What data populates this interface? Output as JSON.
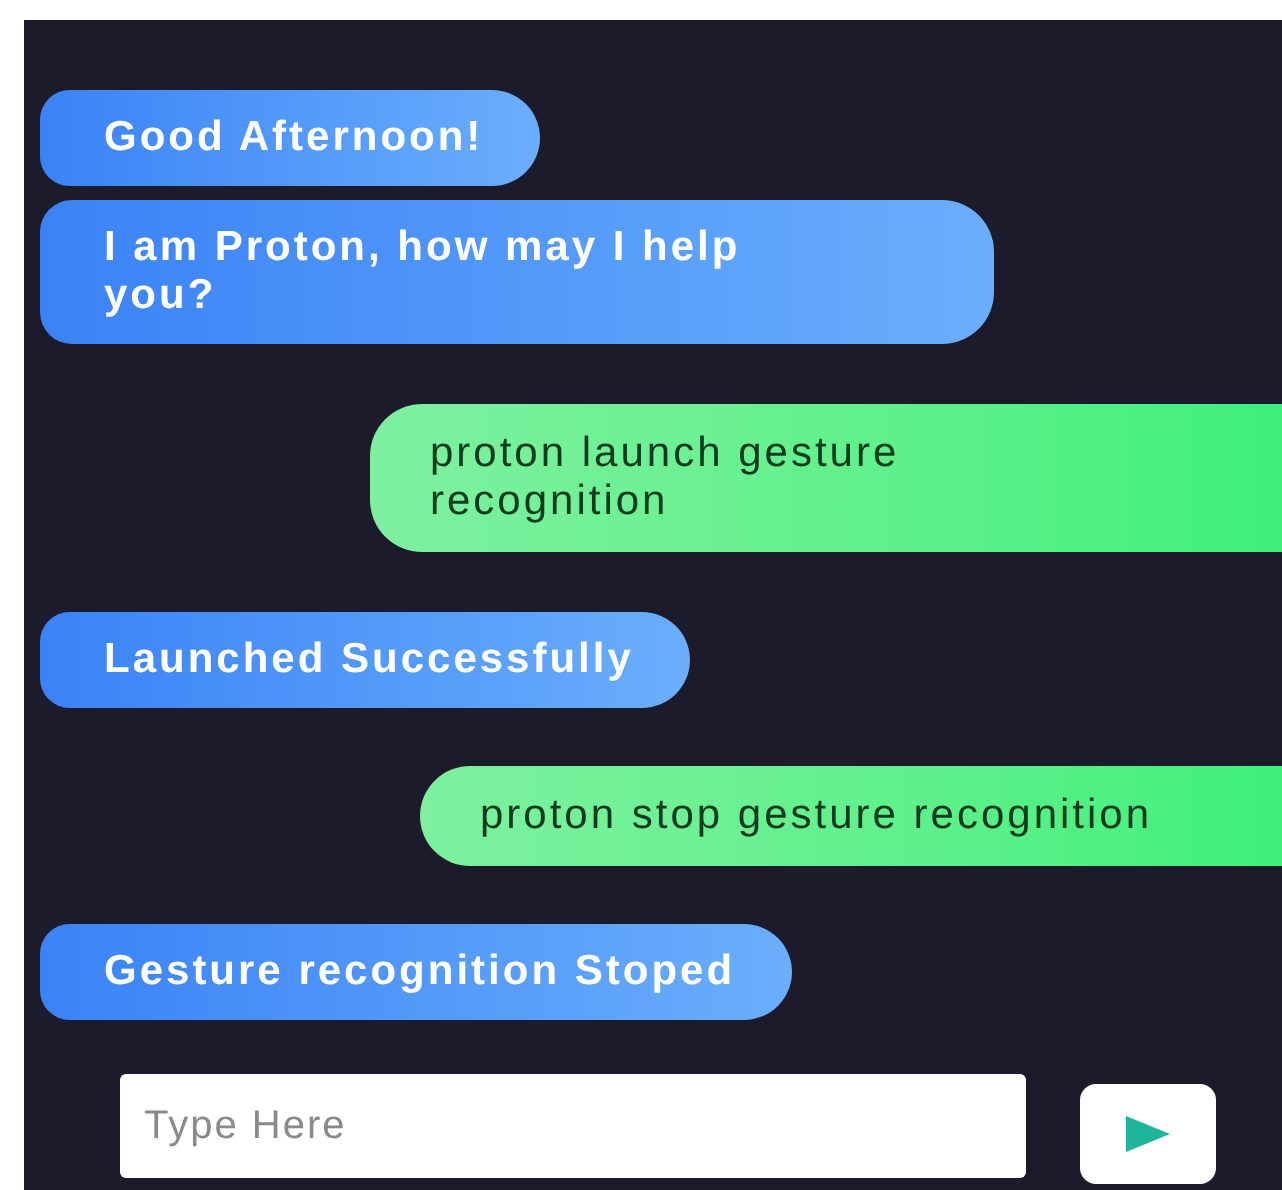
{
  "messages": [
    {
      "kind": "bot",
      "text": "Good Afternoon!"
    },
    {
      "kind": "bot",
      "text": "I am Proton, how may I help you?"
    },
    {
      "kind": "user",
      "text": "proton launch gesture recognition"
    },
    {
      "kind": "bot",
      "text": "Launched Successfully"
    },
    {
      "kind": "user",
      "text": "proton stop gesture recognition"
    },
    {
      "kind": "bot",
      "text": "Gesture recognition Stoped"
    }
  ],
  "input": {
    "placeholder": "Type Here"
  }
}
